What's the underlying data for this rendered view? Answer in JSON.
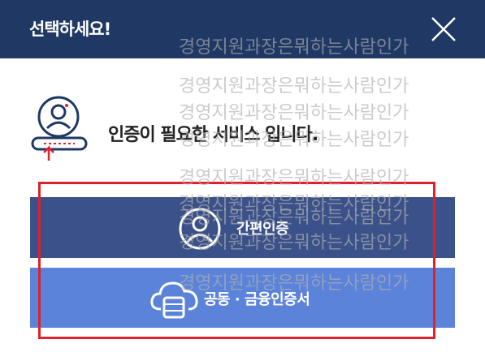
{
  "header": {
    "title": "선택하세요!"
  },
  "intro": {
    "text": "인증이 필요한 서비스 입니다."
  },
  "buttons": {
    "simple_auth": {
      "label": "간편인증"
    },
    "certificate": {
      "label": "공동 · 금융인증서"
    }
  },
  "watermark": {
    "text": "경영지원과장은뭐하는사람인가"
  },
  "colors": {
    "header_bg": "#1f3864",
    "simple_btn_bg": "#3a5189",
    "cert_btn_bg": "#5b83da",
    "highlight": "#e0202a"
  },
  "icons": {
    "close": "close-icon",
    "intro": "user-login-icon",
    "simple": "user-circle-icon",
    "certificate": "cloud-server-icon"
  }
}
